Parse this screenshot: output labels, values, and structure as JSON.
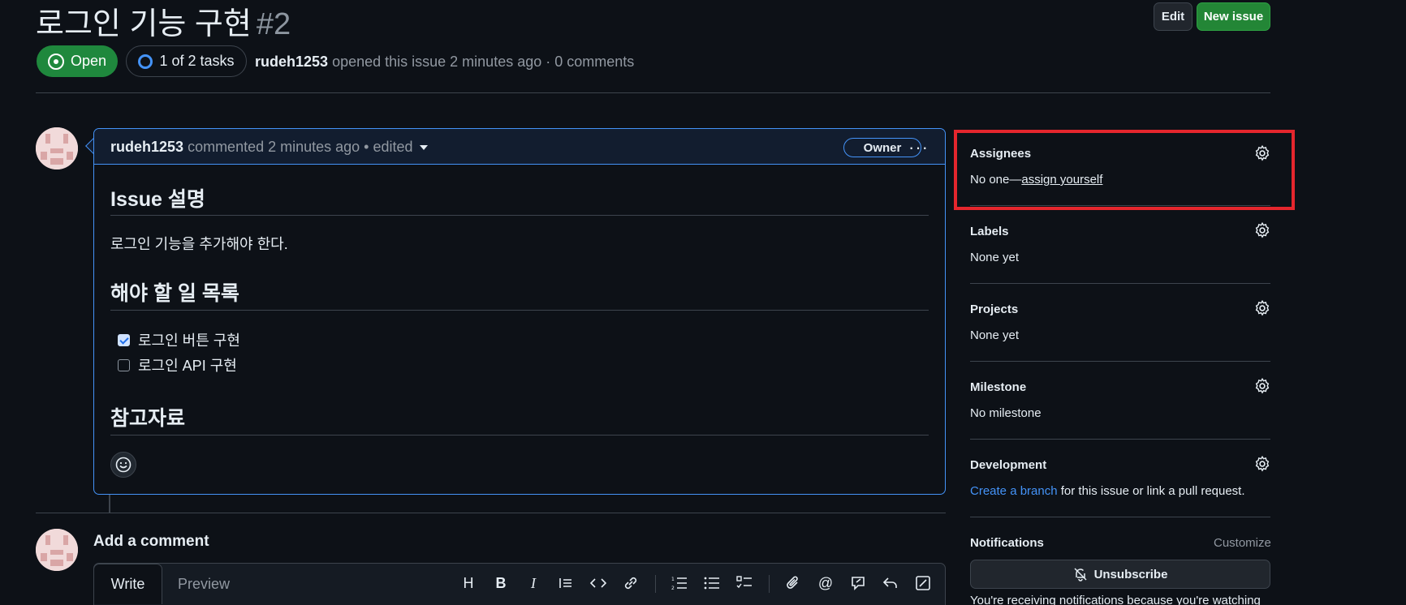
{
  "issue": {
    "title": "로그인 기능 구현",
    "number": "#2",
    "state": "Open",
    "tasks": "1 of 2 tasks",
    "author": "rudeh1253",
    "meta_text": "opened this issue 2 minutes ago · 0 comments"
  },
  "header_buttons": {
    "edit": "Edit",
    "new_issue": "New issue"
  },
  "comment": {
    "author": "rudeh1253",
    "meta_text": "commented 2 minutes ago • edited",
    "badge": "Owner",
    "more": "···",
    "heading1": "Issue 설명",
    "paragraph": "로그인 기능을 추가해야 한다.",
    "heading2": "해야 할 일 목록",
    "tasks": [
      {
        "label": "로그인 버튼 구현",
        "checked": true
      },
      {
        "label": "로그인 API 구현",
        "checked": false
      }
    ],
    "heading3": "참고자료"
  },
  "add_comment": {
    "title": "Add a comment",
    "tab_write": "Write",
    "tab_preview": "Preview"
  },
  "sidebar": {
    "assignees": {
      "title": "Assignees",
      "prefix": "No one—",
      "link": "assign yourself"
    },
    "labels": {
      "title": "Labels",
      "text": "None yet"
    },
    "projects": {
      "title": "Projects",
      "text": "None yet"
    },
    "milestone": {
      "title": "Milestone",
      "text": "No milestone"
    },
    "development": {
      "title": "Development",
      "link": "Create a branch",
      "text": " for this issue or link a pull request."
    },
    "notifications": {
      "title": "Notifications",
      "customize": "Customize",
      "unsubscribe": "Unsubscribe",
      "receiving": "You're receiving notifications because you're watching"
    }
  },
  "colors": {
    "accent": "#4493f8",
    "open_green": "#1f883d",
    "highlight_red": "#e5262d"
  }
}
